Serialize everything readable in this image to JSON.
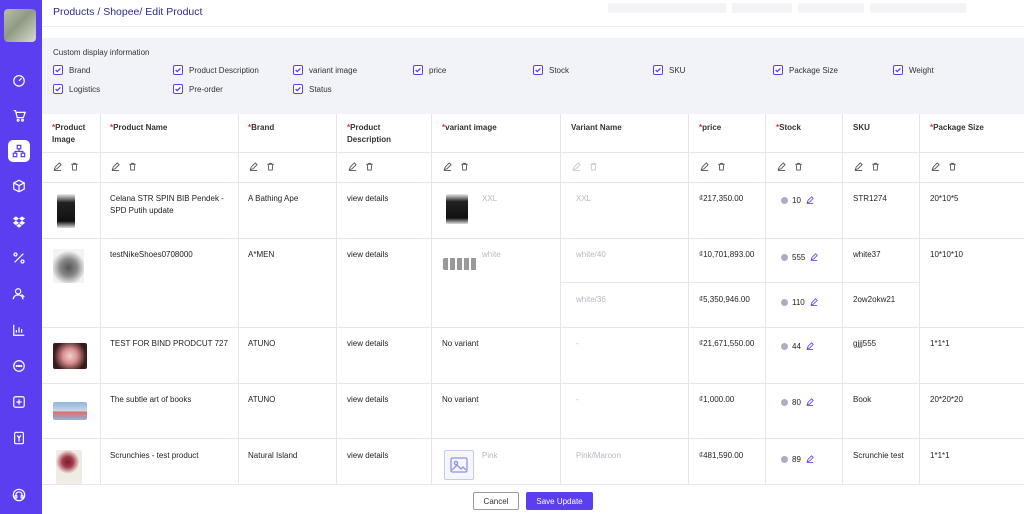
{
  "breadcrumb": "Products / Shopee/ Edit Product",
  "options": {
    "title": "Custom display information",
    "items": [
      "Brand",
      "Product Description",
      "variant image",
      "price",
      "Stock",
      "SKU",
      "Package Size",
      "Weight",
      "Logistics",
      "Pre-order",
      "Status"
    ]
  },
  "table": {
    "headers": [
      {
        "req": "*",
        "label": "Product Image"
      },
      {
        "req": "*",
        "label": "Product Name"
      },
      {
        "req": "*",
        "label": "Brand"
      },
      {
        "req": "*",
        "label": "Product Description"
      },
      {
        "req": "*",
        "label": "variant image"
      },
      {
        "req": "",
        "label": "Variant Name"
      },
      {
        "req": "*",
        "label": "price"
      },
      {
        "req": "*",
        "label": "Stock"
      },
      {
        "req": "",
        "label": "SKU"
      },
      {
        "req": "*",
        "label": "Package Size"
      }
    ],
    "rows": [
      {
        "name": "Celana STR SPIN BIB Pendek - SPD Putih update",
        "brand": "A Bathing Ape",
        "desc": "view details",
        "variant_image": "XXL",
        "variant_name": "XXL",
        "price": "₫217,350.00",
        "stock": "10",
        "sku": "STR1274",
        "package": "20*10*5"
      },
      {
        "name": "testNikeShoes0708000",
        "brand": "A*MEN",
        "desc": "view details",
        "variant_image": "white",
        "variant_name": "white/40",
        "price": "₫10,701,893.00",
        "stock": "555",
        "sku": "white37",
        "package": "10*10*10"
      },
      {
        "variant_name": "white/36",
        "price": "₫5,350,946.00",
        "stock": "110",
        "sku": "2ow2okw21"
      },
      {
        "name": "TEST FOR BIND PRODCUT 727",
        "brand": "ATUNO",
        "desc": "view details",
        "variant_image": "No variant",
        "variant_name": "-",
        "price": "₫21,671,550.00",
        "stock": "44",
        "sku": "gjjj555",
        "package": "1*1*1"
      },
      {
        "name": "The subtle art of books",
        "brand": "ATUNO",
        "desc": "view details",
        "variant_image": "No variant",
        "variant_name": "-",
        "price": "₫1,000.00",
        "stock": "80",
        "sku": "Book",
        "package": "20*20*20"
      },
      {
        "name": "Scrunchies - test product",
        "brand": "Natural Island",
        "desc": "view details",
        "variant_image": "Pink",
        "variant_name": "Pink/Maroon",
        "price": "₫481,590.00",
        "stock": "89",
        "sku": "Scrunchie test",
        "package": "1*1*1"
      }
    ]
  },
  "footer": {
    "cancel": "Cancel",
    "save": "Save Update"
  },
  "colors": {
    "accent": "#5b3ef0",
    "required": "#e2372b"
  }
}
